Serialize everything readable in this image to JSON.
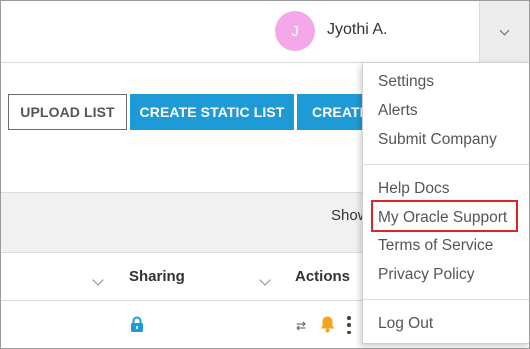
{
  "header": {
    "avatar_initial": "J",
    "user_name": "Jyothi A.",
    "avatar_color": "#f4a8ea"
  },
  "toolbar": {
    "upload_label": "UPLOAD LIST",
    "static_label": "CREATE STATIC LIST",
    "create_label": "CREATE",
    "accent_color": "#1e9ad6"
  },
  "band": {
    "show_text": "Show"
  },
  "table": {
    "columns": [
      "Sharing",
      "Actions"
    ]
  },
  "row": {
    "swap_glyph": "⇄"
  },
  "menu": {
    "group1": [
      "Settings",
      "Alerts",
      "Submit Company"
    ],
    "group2": [
      "Help Docs",
      "My Oracle Support",
      "Terms of Service",
      "Privacy Policy"
    ],
    "group3": [
      "Log Out"
    ],
    "highlighted_item": "My Oracle Support",
    "highlight_color": "#e02323"
  },
  "icons": [
    "chevron-down-icon",
    "lock-icon",
    "swap-icon",
    "bell-icon",
    "kebab-icon"
  ]
}
